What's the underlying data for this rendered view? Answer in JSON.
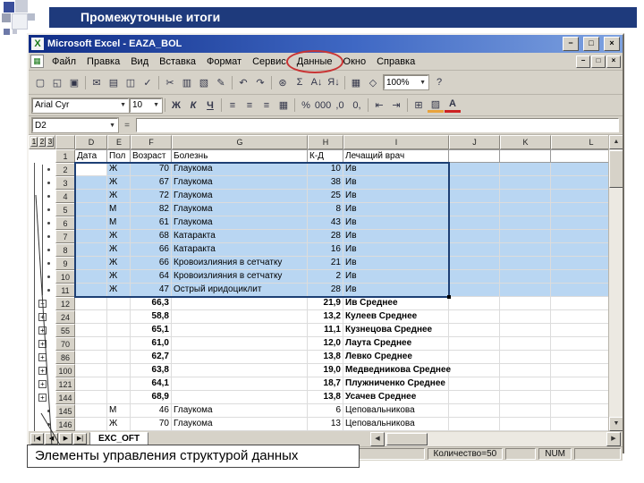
{
  "slide": {
    "title": "Промежуточные итоги",
    "caption": "Элементы управления структурой данных"
  },
  "icons": {
    "app": "X",
    "workbook": "▦",
    "minimize": "−",
    "maximize": "□",
    "close": "×",
    "dropdown": "▼",
    "scroll_up": "▲",
    "scroll_down": "▼",
    "scroll_left": "◀",
    "scroll_right": "▶",
    "tab_first": "|◀",
    "tab_prev": "◀",
    "tab_next": "▶",
    "tab_last": "▶|",
    "fx": "="
  },
  "colors": {
    "selection_fill": "#b9d6f2",
    "annotation_red": "#c93333",
    "slide_titlebar": "#1e3a7c"
  },
  "excel": {
    "title": "Microsoft Excel - EAZA_BOL",
    "menus": [
      "Файл",
      "Правка",
      "Вид",
      "Вставка",
      "Формат",
      "Сервис",
      "Данные",
      "Окно",
      "Справка"
    ],
    "circled_menu": "Данные",
    "name_box": "D2",
    "formula_value": "",
    "toolbar": {
      "zoom": "100%",
      "icons": [
        {
          "n": "new-document-icon",
          "g": "▢"
        },
        {
          "n": "open-folder-icon",
          "g": "◱"
        },
        {
          "n": "save-icon",
          "g": "▣"
        },
        {
          "n": "separator"
        },
        {
          "n": "email-icon",
          "g": "✉"
        },
        {
          "n": "print-icon",
          "g": "▤"
        },
        {
          "n": "print-preview-icon",
          "g": "◫"
        },
        {
          "n": "spelling-icon",
          "g": "✓"
        },
        {
          "n": "separator"
        },
        {
          "n": "cut-icon",
          "g": "✂"
        },
        {
          "n": "copy-icon",
          "g": "▥"
        },
        {
          "n": "paste-icon",
          "g": "▧"
        },
        {
          "n": "format-painter-icon",
          "g": "✎"
        },
        {
          "n": "separator"
        },
        {
          "n": "undo-icon",
          "g": "↶"
        },
        {
          "n": "redo-icon",
          "g": "↷"
        },
        {
          "n": "separator"
        },
        {
          "n": "hyperlink-icon",
          "g": "⊛"
        },
        {
          "n": "autosum-icon",
          "g": "Σ"
        },
        {
          "n": "sort-ascending-icon",
          "g": "А↓"
        },
        {
          "n": "sort-descending-icon",
          "g": "Я↓"
        },
        {
          "n": "separator"
        },
        {
          "n": "chart-wizard-icon",
          "g": "▦"
        },
        {
          "n": "drawing-icon",
          "g": "◇"
        }
      ],
      "icons_after_zoom": [
        {
          "n": "help-icon",
          "g": "?"
        }
      ]
    },
    "format_toolbar": {
      "font": "Arial Cyr",
      "size": "10",
      "buttons": [
        {
          "n": "bold-button",
          "g": "Ж"
        },
        {
          "n": "italic-button",
          "g": "К"
        },
        {
          "n": "underline-button",
          "g": "Ч"
        },
        {
          "n": "separator"
        },
        {
          "n": "align-left-button",
          "g": "≡"
        },
        {
          "n": "align-center-button",
          "g": "≡"
        },
        {
          "n": "align-right-button",
          "g": "≡"
        },
        {
          "n": "merge-center-button",
          "g": "▦"
        },
        {
          "n": "separator"
        },
        {
          "n": "percent-style-button",
          "g": "%"
        },
        {
          "n": "comma-style-button",
          "g": "000"
        },
        {
          "n": "increase-decimal-button",
          "g": ",0"
        },
        {
          "n": "decrease-decimal-button",
          "g": "0,"
        },
        {
          "n": "separator"
        },
        {
          "n": "decrease-indent-button",
          "g": "⇤"
        },
        {
          "n": "increase-indent-button",
          "g": "⇥"
        },
        {
          "n": "separator"
        },
        {
          "n": "borders-button",
          "g": "⊞"
        },
        {
          "n": "fill-color-button",
          "g": "▨"
        },
        {
          "n": "font-color-button",
          "g": "А"
        }
      ]
    },
    "tabs": {
      "nav": [
        "|◀",
        "◀",
        "▶",
        "▶|"
      ],
      "active": "EXC_OFT"
    },
    "status": {
      "count": "Количество=50",
      "num": "NUM"
    }
  },
  "grid": {
    "outline_buttons": [
      "1",
      "2",
      "3"
    ],
    "col_letters": [
      "D",
      "E",
      "F",
      "G",
      "H",
      "I",
      "J",
      "K",
      "L"
    ],
    "rows": [
      {
        "n": "1",
        "o": "",
        "t": "h",
        "sel": false,
        "c": [
          "Дата",
          "Пол",
          "Возраст",
          "Болезнь",
          "К-Д",
          "Лечащий врач"
        ]
      },
      {
        "n": "2",
        "o": "dot",
        "t": "d",
        "sel": true,
        "c": [
          "",
          "Ж",
          "70",
          "Глаукома",
          "10",
          "Ив"
        ]
      },
      {
        "n": "3",
        "o": "dot",
        "t": "d",
        "sel": true,
        "c": [
          "",
          "Ж",
          "67",
          "Глаукома",
          "38",
          "Ив"
        ]
      },
      {
        "n": "4",
        "o": "dot",
        "t": "d",
        "sel": true,
        "c": [
          "",
          "Ж",
          "72",
          "Глаукома",
          "25",
          "Ив"
        ]
      },
      {
        "n": "5",
        "o": "dot",
        "t": "d",
        "sel": true,
        "c": [
          "",
          "М",
          "82",
          "Глаукома",
          "8",
          "Ив"
        ]
      },
      {
        "n": "6",
        "o": "dot",
        "t": "d",
        "sel": true,
        "c": [
          "",
          "М",
          "61",
          "Глаукома",
          "43",
          "Ив"
        ]
      },
      {
        "n": "7",
        "o": "dot",
        "t": "d",
        "sel": true,
        "c": [
          "",
          "Ж",
          "68",
          "Катаракта",
          "28",
          "Ив"
        ]
      },
      {
        "n": "8",
        "o": "dot",
        "t": "d",
        "sel": true,
        "c": [
          "",
          "Ж",
          "66",
          "Катаракта",
          "16",
          "Ив"
        ]
      },
      {
        "n": "9",
        "o": "dot",
        "t": "d",
        "sel": true,
        "c": [
          "",
          "Ж",
          "66",
          "Кровоизлияния в сетчатку",
          "21",
          "Ив"
        ]
      },
      {
        "n": "10",
        "o": "dot",
        "t": "d",
        "sel": true,
        "c": [
          "",
          "Ж",
          "64",
          "Кровоизлияния в сетчатку",
          "2",
          "Ив"
        ]
      },
      {
        "n": "11",
        "o": "dot",
        "t": "d",
        "sel": true,
        "c": [
          "",
          "Ж",
          "47",
          "Острый иридоциклит",
          "28",
          "Ив"
        ]
      },
      {
        "n": "12",
        "o": "minus",
        "t": "s",
        "sel": false,
        "c": [
          "",
          "",
          "66,3",
          "",
          "21,9",
          "Ив Среднее"
        ]
      },
      {
        "n": "24",
        "o": "plus",
        "t": "s",
        "sel": false,
        "c": [
          "",
          "",
          "58,8",
          "",
          "13,2",
          "Кулеев Среднее"
        ]
      },
      {
        "n": "55",
        "o": "plus",
        "t": "s",
        "sel": false,
        "c": [
          "",
          "",
          "65,1",
          "",
          "11,1",
          "Кузнецова Среднее"
        ]
      },
      {
        "n": "70",
        "o": "plus",
        "t": "s",
        "sel": false,
        "c": [
          "",
          "",
          "61,0",
          "",
          "12,0",
          "Лаута Среднее"
        ]
      },
      {
        "n": "86",
        "o": "plus",
        "t": "s",
        "sel": false,
        "c": [
          "",
          "",
          "62,7",
          "",
          "13,8",
          "Левко Среднее"
        ]
      },
      {
        "n": "100",
        "o": "plus",
        "t": "s",
        "sel": false,
        "c": [
          "",
          "",
          "63,8",
          "",
          "19,0",
          "Медведникова Среднее"
        ]
      },
      {
        "n": "121",
        "o": "plus",
        "t": "s",
        "sel": false,
        "c": [
          "",
          "",
          "64,1",
          "",
          "18,7",
          "Плужниченко Среднее"
        ]
      },
      {
        "n": "144",
        "o": "plus",
        "t": "s",
        "sel": false,
        "c": [
          "",
          "",
          "68,9",
          "",
          "13,8",
          "Усачев Среднее"
        ]
      },
      {
        "n": "145",
        "o": "dot",
        "t": "d",
        "sel": false,
        "c": [
          "",
          "М",
          "46",
          "Глаукома",
          "6",
          "Цеповальникова"
        ]
      },
      {
        "n": "146",
        "o": "dot",
        "t": "d",
        "sel": false,
        "c": [
          "",
          "Ж",
          "70",
          "Глаукома",
          "13",
          "Цеповальникова"
        ]
      }
    ]
  }
}
